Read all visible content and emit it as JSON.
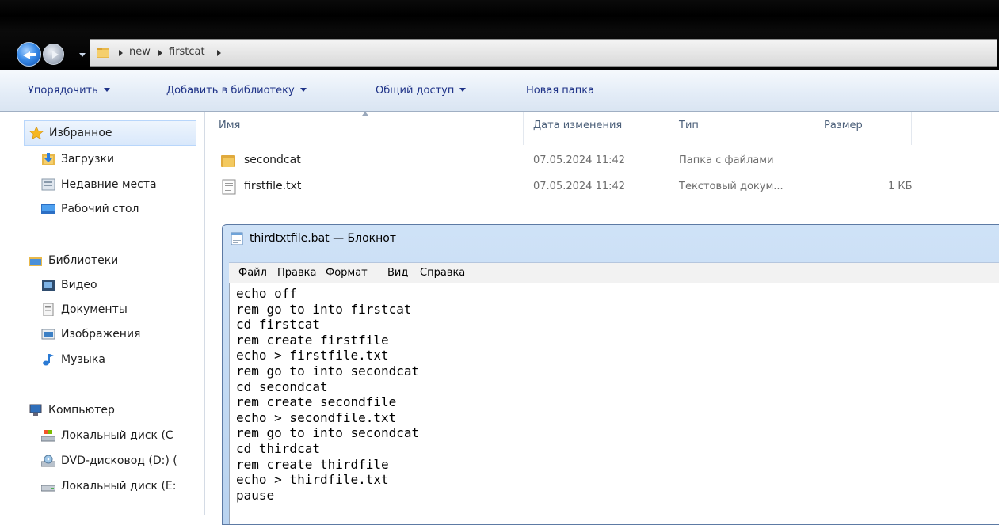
{
  "address": {
    "crumbs": [
      "new",
      "firstcat"
    ]
  },
  "toolbar": {
    "organize": "Упорядочить",
    "add_to_library": "Добавить в библиотеку",
    "share": "Общий доступ",
    "new_folder": "Новая папка"
  },
  "nav": {
    "favorites": "Избранное",
    "downloads": "Загрузки",
    "recent": "Недавние места",
    "desktop": "Рабочий стол",
    "libraries": "Библиотеки",
    "video": "Видео",
    "documents": "Документы",
    "images": "Изображения",
    "music": "Музыка",
    "computer": "Компьютер",
    "disk_c": "Локальный диск (C",
    "dvd": "DVD-дисковод (D:) (",
    "disk_e": "Локальный диск (E:"
  },
  "columns": {
    "name": "Имя",
    "date": "Дата изменения",
    "type": "Тип",
    "size": "Размер"
  },
  "files": [
    {
      "name": "secondcat",
      "date": "07.05.2024 11:42",
      "type": "Папка с файлами",
      "size": "",
      "icon": "folder-icon"
    },
    {
      "name": "firstfile.txt",
      "date": "07.05.2024 11:42",
      "type": "Текстовый докум...",
      "size": "1 КБ",
      "icon": "text-file-icon"
    }
  ],
  "notepad": {
    "title": "thirdtxtfile.bat — Блокнот",
    "menu": [
      "Файл",
      "Правка",
      "Формат",
      "Вид",
      "Справка"
    ],
    "lines": [
      "echo off",
      "rem go to into firstcat",
      "cd firstcat",
      "rem create firstfile",
      "echo > firstfile.txt",
      "rem go to into secondcat",
      "cd secondcat",
      "rem create secondfile",
      "echo > secondfile.txt",
      "rem go to into secondcat",
      "cd thirdcat",
      "rem create thirdfile",
      "echo > thirdfile.txt",
      "pause"
    ]
  },
  "colors": {
    "toolbar_text": "#1e3287",
    "window_frame": "#b9d3f0",
    "folder": "#e8b84a"
  }
}
